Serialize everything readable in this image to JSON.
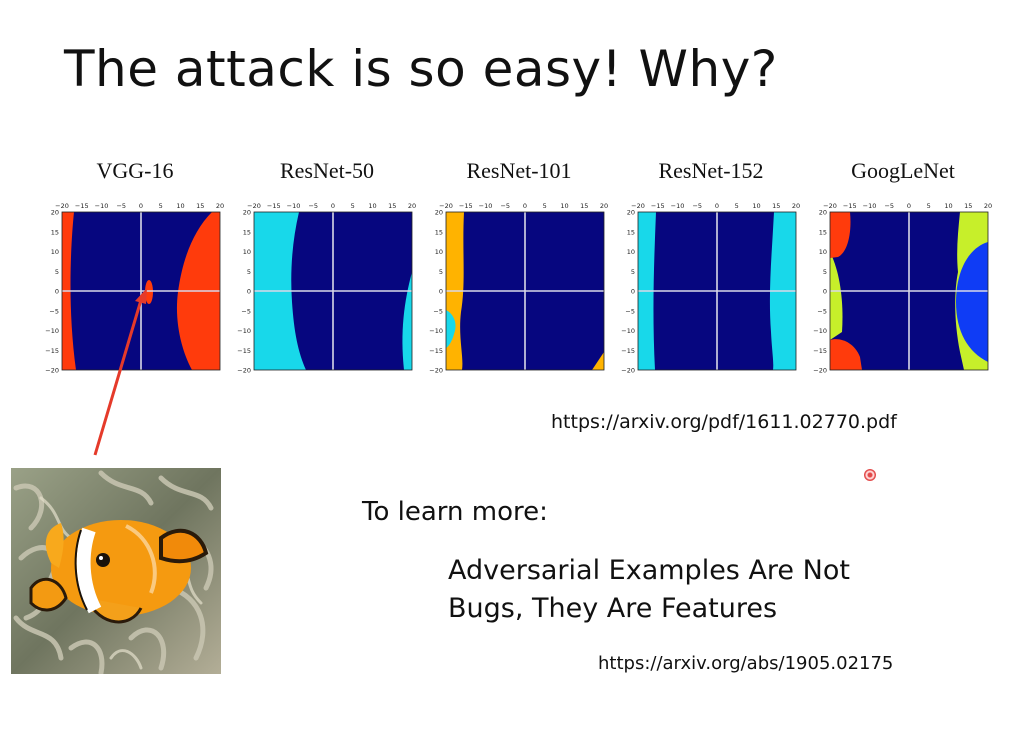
{
  "slide": {
    "title": "The attack is so easy! Why?",
    "url_1": "https://arxiv.org/pdf/1611.02770.pdf",
    "learn_more": "To learn more:",
    "paper_title_line1": "Adversarial Examples Are Not",
    "paper_title_line2": "Bugs, They Are Features",
    "url_2": "https://arxiv.org/abs/1905.02175"
  },
  "panels": [
    {
      "name": "VGG-16"
    },
    {
      "name": "ResNet-50"
    },
    {
      "name": "ResNet-101"
    },
    {
      "name": "ResNet-152"
    },
    {
      "name": "GoogLeNet"
    }
  ],
  "axis": {
    "x_ticks": [
      "-20",
      "-15",
      "-10",
      "-5",
      "0",
      "5",
      "10",
      "15",
      "20"
    ],
    "y_ticks": [
      "20",
      "15",
      "10",
      "5",
      "0",
      "-5",
      "-10",
      "-15",
      "-20"
    ]
  },
  "colors": {
    "navy": "#06067f",
    "orange_red": "#ff3b0c",
    "cyan": "#18d8ea",
    "amber": "#ffb300",
    "lime": "#c7ef2a",
    "blue": "#0f3cf5",
    "arrow": "#e53a2a"
  }
}
